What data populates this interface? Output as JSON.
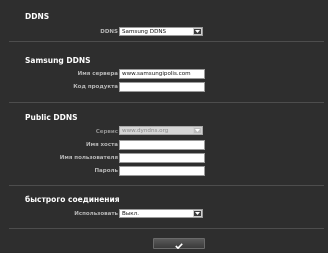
{
  "ddns": {
    "title": "DDNS",
    "label": "DDNS",
    "value": "Samsung DDNS"
  },
  "samsung_ddns": {
    "title": "Samsung DDNS",
    "server_label": "Имя сервера",
    "server_value": "www.samsungipolis.com",
    "product_code_label": "Код продукта",
    "product_code_value": ""
  },
  "public_ddns": {
    "title": "Public DDNS",
    "service_label": "Сервис",
    "service_value": "www.dyndns.org",
    "host_label": "Имя хоста",
    "host_value": "",
    "user_label": "Имя пользователя",
    "user_value": "",
    "password_label": "Пароль",
    "password_value": ""
  },
  "quick_connect": {
    "title": "быстрого соединения",
    "use_label": "Использовать",
    "use_value": "Выкл."
  },
  "apply_button": {
    "icon": "check-icon"
  }
}
